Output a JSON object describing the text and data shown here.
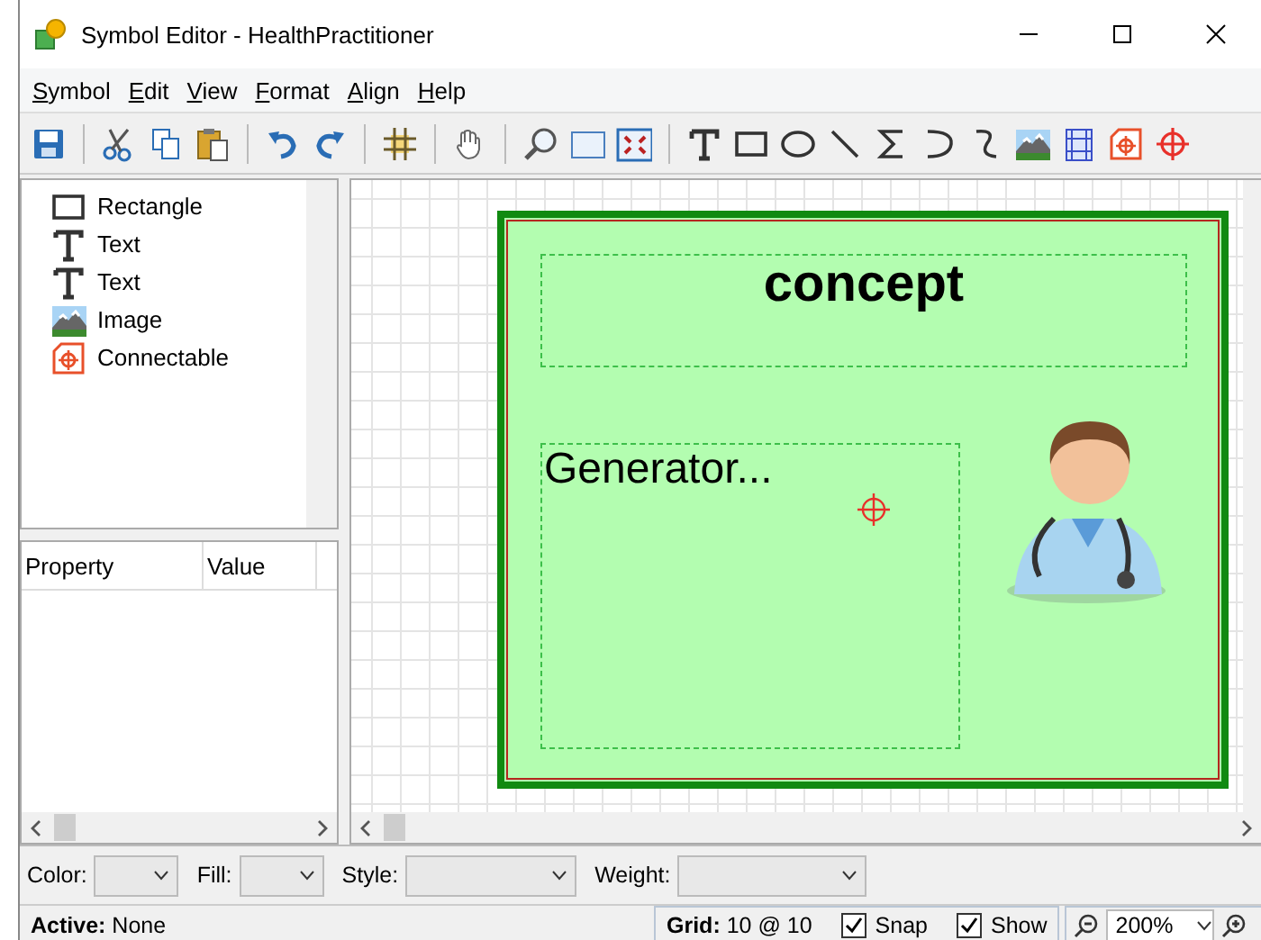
{
  "window": {
    "title": "Symbol Editor - HealthPractitioner"
  },
  "menu": [
    {
      "label": "Symbol"
    },
    {
      "label": "Edit"
    },
    {
      "label": "View"
    },
    {
      "label": "Format"
    },
    {
      "label": "Align"
    },
    {
      "label": "Help"
    }
  ],
  "toolbar": [
    {
      "kind": "save"
    },
    {
      "kind": "sep"
    },
    {
      "kind": "cut"
    },
    {
      "kind": "copy"
    },
    {
      "kind": "paste"
    },
    {
      "kind": "sep"
    },
    {
      "kind": "undo"
    },
    {
      "kind": "redo"
    },
    {
      "kind": "sep"
    },
    {
      "kind": "grid"
    },
    {
      "kind": "sep"
    },
    {
      "kind": "hand"
    },
    {
      "kind": "sep"
    },
    {
      "kind": "zoom"
    },
    {
      "kind": "frame"
    },
    {
      "kind": "fit"
    },
    {
      "kind": "sep"
    },
    {
      "kind": "text"
    },
    {
      "kind": "rectangle"
    },
    {
      "kind": "ellipse"
    },
    {
      "kind": "line"
    },
    {
      "kind": "sigma"
    },
    {
      "kind": "arc"
    },
    {
      "kind": "curve"
    },
    {
      "kind": "image"
    },
    {
      "kind": "bounds"
    },
    {
      "kind": "connectable"
    },
    {
      "kind": "target"
    }
  ],
  "tree": [
    {
      "kind": "rectangle",
      "label": "Rectangle"
    },
    {
      "kind": "text",
      "label": "Text"
    },
    {
      "kind": "text",
      "label": "Text"
    },
    {
      "kind": "image",
      "label": "Image"
    },
    {
      "kind": "connectable",
      "label": "Connectable"
    }
  ],
  "properties": {
    "columns": [
      "Property",
      "Value"
    ]
  },
  "symbol": {
    "title": "concept",
    "text": "Generator..."
  },
  "format_bar": [
    {
      "label": "Color:"
    },
    {
      "label": "Fill:"
    },
    {
      "label": "Style:"
    },
    {
      "label": "Weight:"
    }
  ],
  "status_bar": {
    "active": "**Active:** None",
    "grid": "**Grid:** 10 @ 10",
    "options": [
      {
        "label": "Snap",
        "checked": true
      },
      {
        "label": "Show",
        "checked": true
      }
    ],
    "zoom": "200%"
  }
}
